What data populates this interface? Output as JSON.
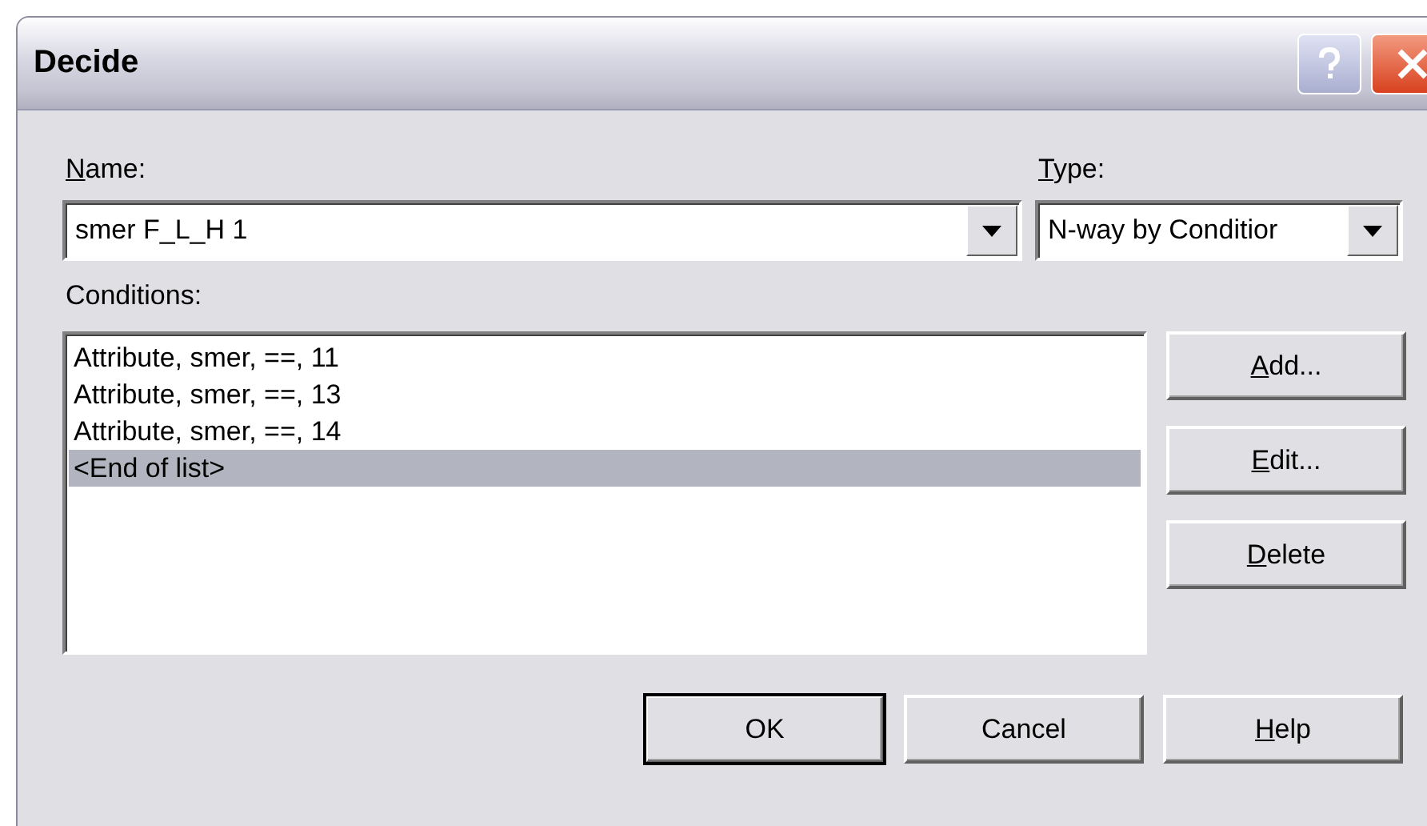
{
  "window": {
    "title": "Decide"
  },
  "name_field": {
    "label": "Name:",
    "label_mnemonic": true,
    "value": "smer F_L_H 1"
  },
  "type_field": {
    "label": "Type:",
    "label_mnemonic": true,
    "value": "N-way by Conditior"
  },
  "conditions": {
    "label": "Conditions:",
    "items": [
      {
        "text": "Attribute, smer, ==, 11",
        "selected": false
      },
      {
        "text": "Attribute, smer, ==, 13",
        "selected": false
      },
      {
        "text": "Attribute, smer, ==, 14",
        "selected": false
      },
      {
        "text": "<End of list>",
        "selected": true
      }
    ]
  },
  "side_buttons": [
    {
      "label": "Add...",
      "mnemonic": true
    },
    {
      "label": "Edit...",
      "mnemonic": true
    },
    {
      "label": "Delete",
      "mnemonic": true
    }
  ],
  "buttons": [
    {
      "label": "OK",
      "mnemonic": false,
      "default": true
    },
    {
      "label": "Cancel",
      "mnemonic": false,
      "default": false
    },
    {
      "label": "Help",
      "mnemonic": true,
      "default": false
    }
  ]
}
